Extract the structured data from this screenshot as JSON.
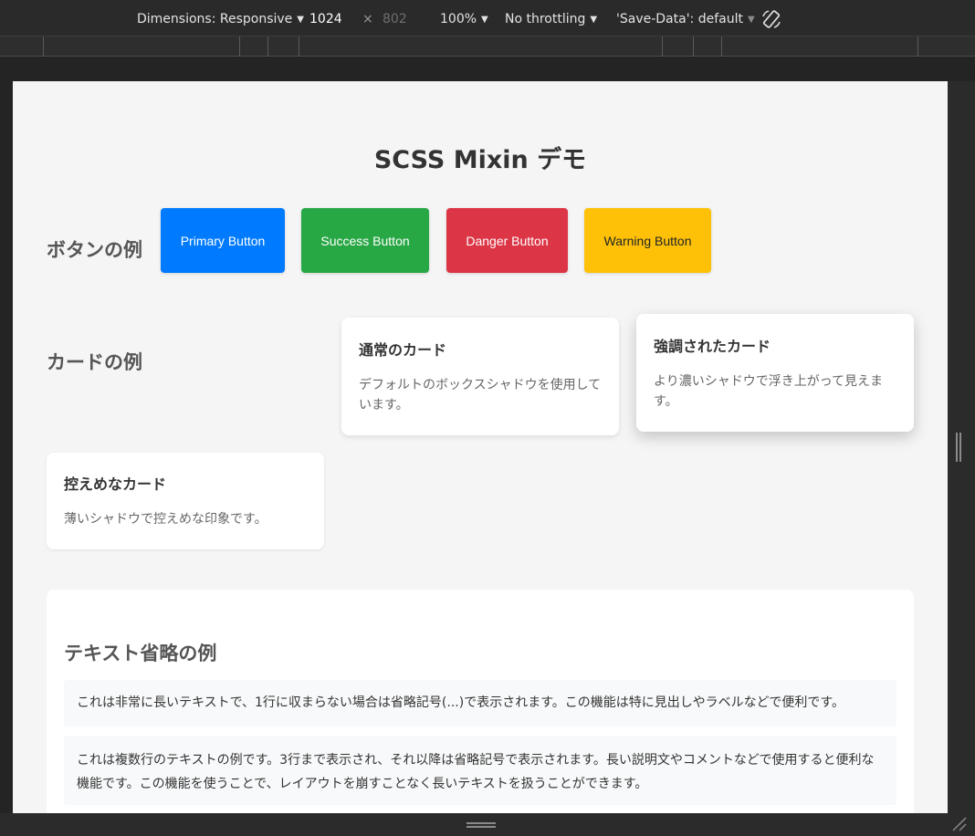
{
  "devtools": {
    "dimensions_label": "Dimensions: Responsive",
    "width_value": "1024",
    "x_sep": "×",
    "height_value": "802",
    "zoom_label": "100%",
    "throttling_label": "No throttling",
    "save_data_label": "'Save-Data': default",
    "caret": "▼"
  },
  "page": {
    "title": "SCSS Mixin デモ",
    "buttons_label": "ボタンの例",
    "buttons": [
      {
        "label": "Primary Button",
        "color": "#007bff",
        "text_color": "#ffffff"
      },
      {
        "label": "Success Button",
        "color": "#28a745",
        "text_color": "#ffffff"
      },
      {
        "label": "Danger Button",
        "color": "#dc3545",
        "text_color": "#ffffff"
      },
      {
        "label": "Warning Button",
        "color": "#ffc107",
        "text_color": "#212529"
      }
    ],
    "cards_label": "カードの例",
    "cards": {
      "normal": {
        "title": "通常のカード",
        "text": "デフォルトのボックスシャドウを使用しています。"
      },
      "elevated": {
        "title": "強調されたカード",
        "text": "より濃いシャドウで浮き上がって見えます。"
      },
      "subtle": {
        "title": "控えめなカード",
        "text": "薄いシャドウで控えめな印象です。"
      }
    },
    "text_section": {
      "title": "テキスト省略の例",
      "single_line": "これは非常に長いテキストで、1行に収まらない場合は省略記号(...)で表示されます。この機能は特に見出しやラベルなどで便利です。",
      "multi_line": "これは複数行のテキストの例です。3行まで表示され、それ以降は省略記号で表示されます。長い説明文やコメントなどで使用すると便利な機能です。この機能を使うことで、レイアウトを崩すことなく長いテキストを扱うことができます。"
    }
  }
}
